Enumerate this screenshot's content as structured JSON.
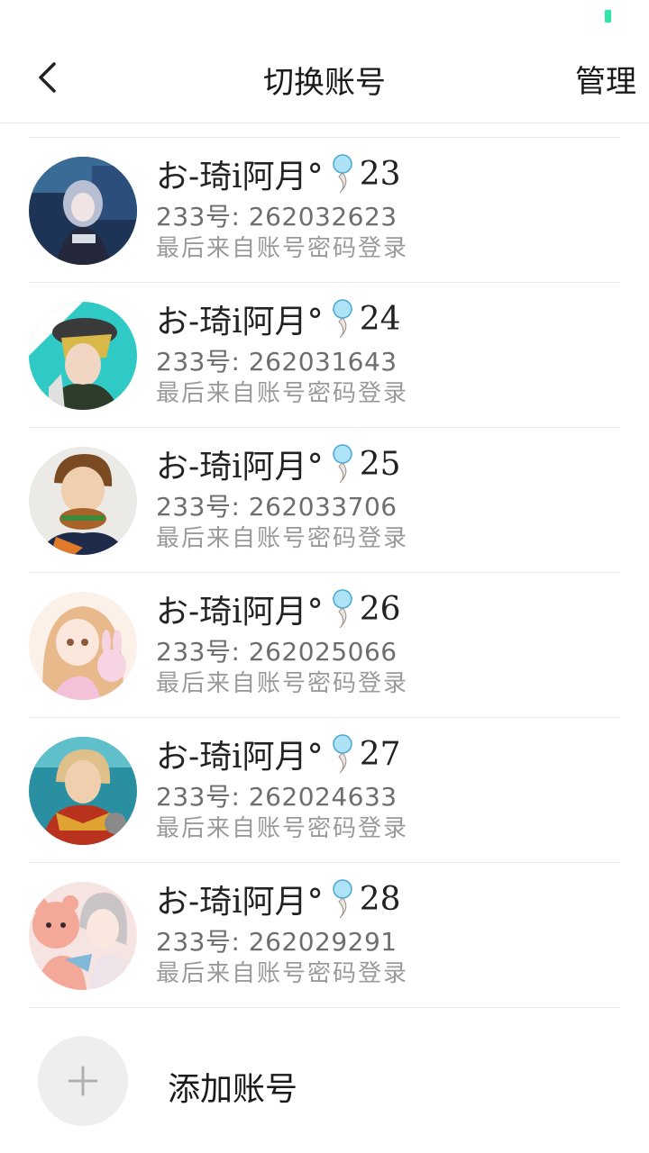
{
  "header": {
    "title": "切换账号",
    "manage_label": "管理"
  },
  "accounts": [
    {
      "name": "お-琦i阿月°",
      "suffix": "23",
      "uid_text": "233号: 262032623",
      "login_text": "最后来自账号密码登录",
      "avatar_icon": "avatar-anime-dark-hair"
    },
    {
      "name": "お-琦i阿月°",
      "suffix": "24",
      "uid_text": "233号: 262031643",
      "login_text": "最后来自账号密码登录",
      "avatar_icon": "avatar-anime-cap"
    },
    {
      "name": "お-琦i阿月°",
      "suffix": "25",
      "uid_text": "233号: 262033706",
      "login_text": "最后来自账号密码登录",
      "avatar_icon": "avatar-anime-burger"
    },
    {
      "name": "お-琦i阿月°",
      "suffix": "26",
      "uid_text": "233号: 262025066",
      "login_text": "最后来自账号密码登录",
      "avatar_icon": "avatar-anime-bunny"
    },
    {
      "name": "お-琦i阿月°",
      "suffix": "27",
      "uid_text": "233号: 262024633",
      "login_text": "最后来自账号密码登录",
      "avatar_icon": "avatar-anime-armor"
    },
    {
      "name": "お-琦i阿月°",
      "suffix": "28",
      "uid_text": "233号: 262029291",
      "login_text": "最后来自账号密码登录",
      "avatar_icon": "avatar-anime-bear"
    }
  ],
  "add_account": {
    "label": "添加账号",
    "icon": "plus-icon"
  },
  "colors": {
    "battery": "#2ee6a6",
    "divider": "#e8e8e8",
    "secondary_text": "#9a9a9a"
  }
}
